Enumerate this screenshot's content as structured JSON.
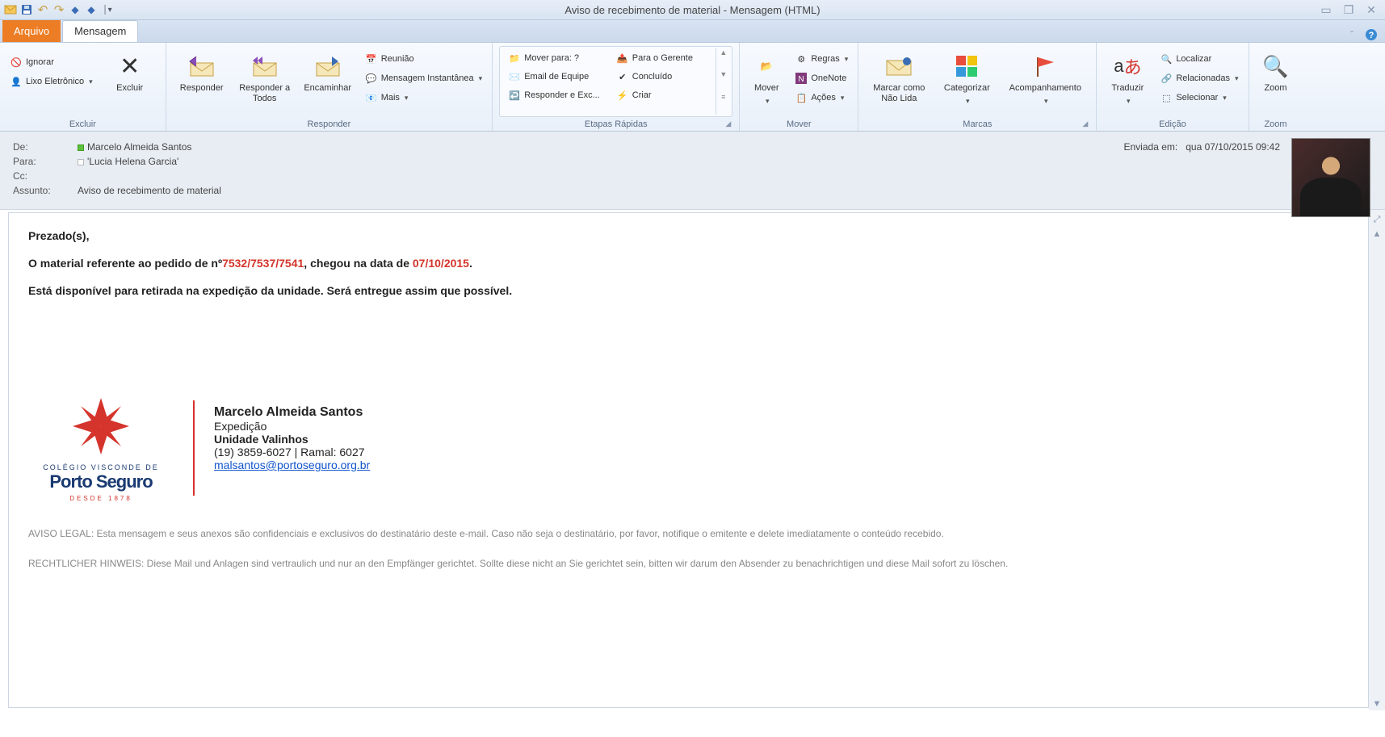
{
  "window": {
    "title": "Aviso de recebimento de material - Mensagem (HTML)"
  },
  "tabs": {
    "arquivo": "Arquivo",
    "mensagem": "Mensagem"
  },
  "ribbon": {
    "excluir": {
      "ignorar": "Ignorar",
      "lixo": "Lixo Eletrônico",
      "excluir": "Excluir",
      "group": "Excluir"
    },
    "responder": {
      "responder": "Responder",
      "todos": "Responder a Todos",
      "encaminhar": "Encaminhar",
      "reuniao": "Reunião",
      "im": "Mensagem Instantânea",
      "mais": "Mais",
      "group": "Responder"
    },
    "etapas": {
      "mover": "Mover para: ?",
      "gerente": "Para o Gerente",
      "email_equipe": "Email de Equipe",
      "concluido": "Concluído",
      "resp_exc": "Responder e Exc...",
      "criar": "Criar",
      "group": "Etapas Rápidas"
    },
    "mover_g": {
      "mover": "Mover",
      "regras": "Regras",
      "onenote": "OneNote",
      "acoes": "Ações",
      "group": "Mover"
    },
    "marcas": {
      "naolida": "Marcar como Não Lida",
      "categorizar": "Categorizar",
      "acomp": "Acompanhamento",
      "group": "Marcas"
    },
    "edicao": {
      "traduzir": "Traduzir",
      "localizar": "Localizar",
      "relacionadas": "Relacionadas",
      "selecionar": "Selecionar",
      "group": "Edição"
    },
    "zoom": {
      "zoom": "Zoom",
      "group": "Zoom"
    }
  },
  "header": {
    "de_label": "De:",
    "de": "Marcelo Almeida Santos",
    "para_label": "Para:",
    "para": "'Lucia Helena Garcia'",
    "cc_label": "Cc:",
    "cc": "",
    "assunto_label": "Assunto:",
    "assunto": "Aviso de recebimento de material",
    "enviada_label": "Enviada em:",
    "enviada": "qua 07/10/2015 09:42"
  },
  "body": {
    "greeting": "Prezado(s),",
    "l1a": "O material referente ao pedido de nº",
    "l1b": "7532/7537/7541",
    "l1c": ", chegou na data de ",
    "l1d": "07/10/2015",
    "l1e": ".",
    "l2": "Está disponível para retirada na expedição da unidade. Será entregue assim que possível."
  },
  "signature": {
    "logo_top": "COLÉGIO VISCONDE DE",
    "logo_main": "Porto Seguro",
    "logo_bottom": "DESDE 1878",
    "name": "Marcelo Almeida Santos",
    "dept": "Expedição",
    "unit": "Unidade Valinhos",
    "phone": "(19) 3859-6027 | Ramal: 6027",
    "email": "malsantos@portoseguro.org.br"
  },
  "legal": {
    "pt": "AVISO LEGAL: Esta mensagem e seus anexos são confidenciais e exclusivos do destinatário deste e-mail. Caso não seja o destinatário, por favor, notifique o emitente e delete imediatamente o conteúdo recebido.",
    "de": "RECHTLICHER HINWEIS: Diese Mail und Anlagen sind vertraulich und nur an den Empfänger gerichtet. Sollte diese nicht an Sie gerichtet sein, bitten wir darum den Absender zu benachrichtigen und diese Mail sofort zu löschen."
  }
}
